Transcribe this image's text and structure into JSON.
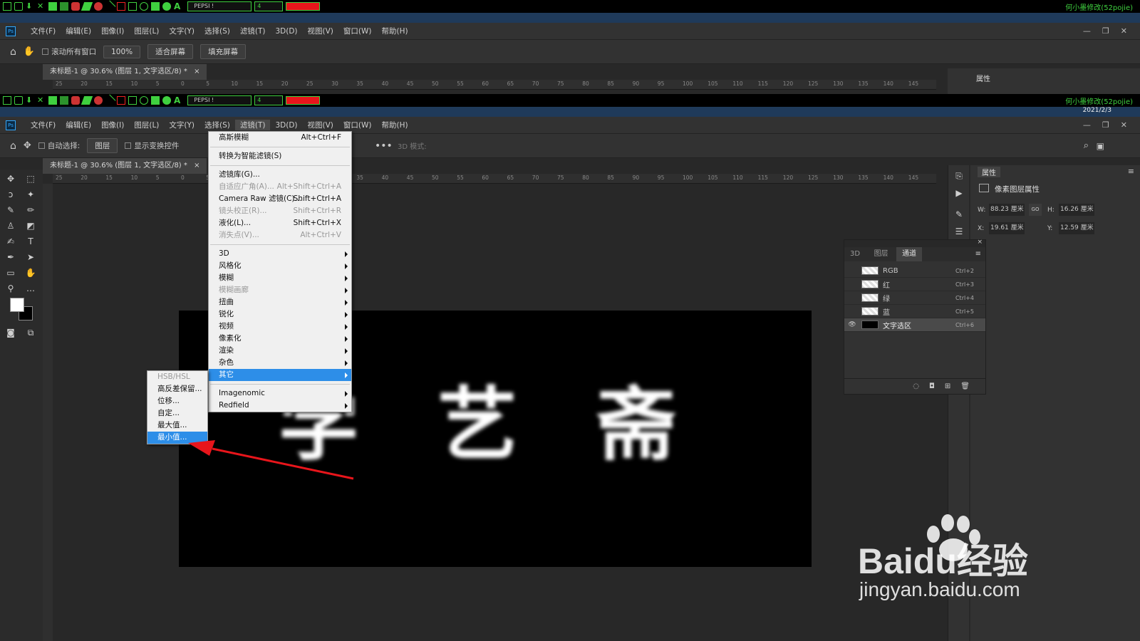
{
  "annotation_bar": {
    "font_field": "PEPSI !",
    "size_field": "4",
    "right_text": "何小墨修改(52pojie)",
    "date": "2021/2/3"
  },
  "menubar": {
    "items": [
      "文件(F)",
      "编辑(E)",
      "图像(I)",
      "图层(L)",
      "文字(Y)",
      "选择(S)",
      "滤镜(T)",
      "3D(D)",
      "视图(V)",
      "窗口(W)",
      "帮助(H)"
    ]
  },
  "top_options": {
    "scroll_all": "滚动所有窗口",
    "zoom": "100%",
    "fit_screen": "适合屏幕",
    "fill_screen": "填充屏幕"
  },
  "options": {
    "auto_select": "自动选择:",
    "layer_select": "图层",
    "show_transform": "显示变换控件",
    "mode_3d": "3D 模式:"
  },
  "document_tab": "未标题-1 @ 30.6% (图层 1, 文字选区/8) *",
  "ruler_labels": [
    "25",
    "20",
    "15",
    "10",
    "5",
    "0",
    "5",
    "10",
    "15",
    "20",
    "25",
    "30",
    "35",
    "40",
    "45",
    "50",
    "55",
    "60",
    "65",
    "70",
    "75",
    "80",
    "85",
    "90",
    "95",
    "100",
    "105",
    "110",
    "115",
    "120",
    "125",
    "130",
    "135",
    "140",
    "145"
  ],
  "filter_menu": [
    {
      "label": "高斯模糊",
      "shortcut": "Alt+Ctrl+F"
    },
    {
      "sep": true
    },
    {
      "label": "转换为智能滤镜(S)"
    },
    {
      "sep": true
    },
    {
      "label": "滤镜库(G)..."
    },
    {
      "label": "自适应广角(A)...",
      "shortcut": "Alt+Shift+Ctrl+A",
      "disabled": true
    },
    {
      "label": "Camera Raw 滤镜(C)...",
      "shortcut": "Shift+Ctrl+A"
    },
    {
      "label": "镜头校正(R)...",
      "shortcut": "Shift+Ctrl+R",
      "disabled": true
    },
    {
      "label": "液化(L)...",
      "shortcut": "Shift+Ctrl+X"
    },
    {
      "label": "消失点(V)...",
      "shortcut": "Alt+Ctrl+V",
      "disabled": true
    },
    {
      "sep": true
    },
    {
      "label": "3D",
      "sub": true
    },
    {
      "label": "风格化",
      "sub": true
    },
    {
      "label": "模糊",
      "sub": true
    },
    {
      "label": "模糊画廊",
      "sub": true,
      "disabled": true
    },
    {
      "label": "扭曲",
      "sub": true
    },
    {
      "label": "锐化",
      "sub": true
    },
    {
      "label": "视频",
      "sub": true
    },
    {
      "label": "像素化",
      "sub": true
    },
    {
      "label": "渲染",
      "sub": true
    },
    {
      "label": "杂色",
      "sub": true
    },
    {
      "label": "其它",
      "sub": true,
      "highlight": true
    },
    {
      "sep": true
    },
    {
      "label": "Imagenomic",
      "sub": true
    },
    {
      "label": "Redfield",
      "sub": true
    }
  ],
  "other_submenu": [
    {
      "label": "HSB/HSL",
      "disabled": true
    },
    {
      "label": "高反差保留..."
    },
    {
      "label": "位移..."
    },
    {
      "label": "自定..."
    },
    {
      "label": "最大值..."
    },
    {
      "label": "最小值...",
      "highlight": true
    }
  ],
  "canvas_text": "学 艺 斋",
  "properties": {
    "title": "属性",
    "subtitle": "像素图层属性",
    "w_label": "W:",
    "w": "88.23 厘米",
    "go": "GO",
    "h_label": "H:",
    "h": "16.26 厘米",
    "x_label": "X:",
    "x": "19.61 厘米",
    "y_label": "Y:",
    "y": "12.59 厘米"
  },
  "channels_panel": {
    "tabs": [
      "3D",
      "图层",
      "通道"
    ],
    "rows": [
      {
        "name": "RGB",
        "shortcut": "Ctrl+2"
      },
      {
        "name": "红",
        "shortcut": "Ctrl+3"
      },
      {
        "name": "绿",
        "shortcut": "Ctrl+4"
      },
      {
        "name": "蓝",
        "shortcut": "Ctrl+5"
      },
      {
        "name": "文字选区",
        "shortcut": "Ctrl+6",
        "visible": true
      }
    ]
  },
  "watermark": {
    "brand": "Baidu经验",
    "url": "jingyan.baidu.com"
  },
  "colors": {
    "accent": "#2d8ee8",
    "arrow": "#e8151b",
    "annot_green": "#3fd03f"
  }
}
